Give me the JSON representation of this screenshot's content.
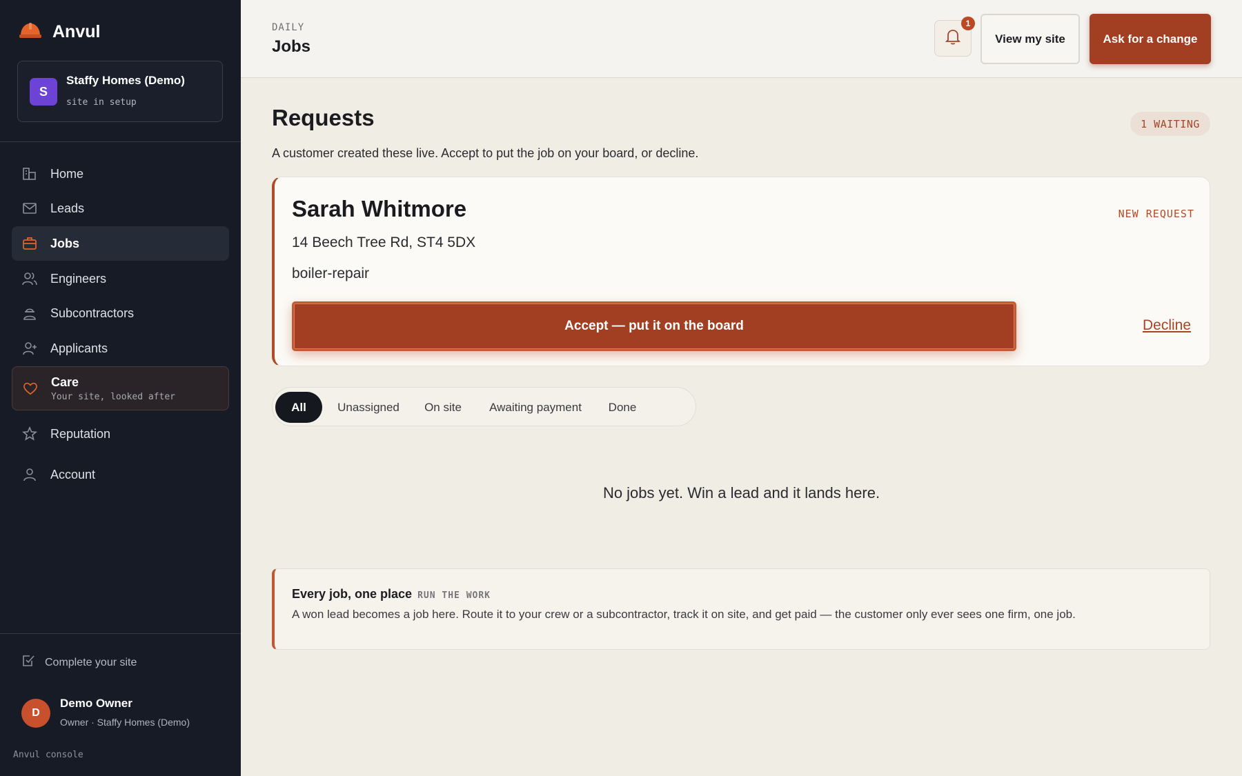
{
  "brand": {
    "name": "Anvul"
  },
  "site": {
    "avatar_letter": "S",
    "name": "Staffy Homes (Demo)",
    "status": "site in setup"
  },
  "nav": [
    {
      "label": "Home",
      "icon": "home-icon"
    },
    {
      "label": "Leads",
      "icon": "mail-icon"
    },
    {
      "label": "Jobs",
      "icon": "briefcase-icon",
      "active": true
    },
    {
      "label": "Engineers",
      "icon": "users-icon"
    },
    {
      "label": "Subcontractors",
      "icon": "worker-icon"
    },
    {
      "label": "Applicants",
      "icon": "user-plus-icon"
    },
    {
      "label": "Care",
      "sublabel": "Your site, looked after",
      "icon": "heart-icon"
    },
    {
      "label": "Reputation",
      "icon": "star-icon"
    },
    {
      "label": "Account",
      "icon": "user-icon"
    }
  ],
  "sidebar_footer": {
    "complete_label": "Complete your site",
    "owner_initial": "D",
    "owner_name": "Demo Owner",
    "owner_role": "Owner · Staffy Homes (Demo)",
    "console_label": "Anvul console"
  },
  "header": {
    "eyebrow": "DAILY",
    "title": "Jobs",
    "notification_count": "1",
    "view_site_label": "View my site",
    "ask_change_label": "Ask for a change"
  },
  "requests": {
    "title": "Requests",
    "waiting_badge": "1 WAITING",
    "description": "A customer created these live. Accept to put the job on your board, or decline.",
    "items": [
      {
        "customer": "Sarah Whitmore",
        "tag": "NEW REQUEST",
        "address": "14 Beech Tree Rd, ST4 5DX",
        "service": "boiler-repair",
        "accept_label": "Accept — put it on the board",
        "decline_label": "Decline"
      }
    ]
  },
  "filters": [
    "All",
    "Unassigned",
    "On site",
    "Awaiting payment",
    "Done"
  ],
  "active_filter": "All",
  "empty_state": "No jobs yet. Win a lead and it lands here.",
  "info": {
    "title": "Every job, one place",
    "tag": "RUN THE WORK",
    "text": "A won lead becomes a job here. Route it to your crew or a subcontractor, track it on site, and get paid — the customer only ever sees one firm, one job."
  },
  "colors": {
    "accent": "#a23f22",
    "sidebar_bg": "#171b26",
    "page_bg": "#f0ede5",
    "site_avatar": "#6d43d6"
  }
}
